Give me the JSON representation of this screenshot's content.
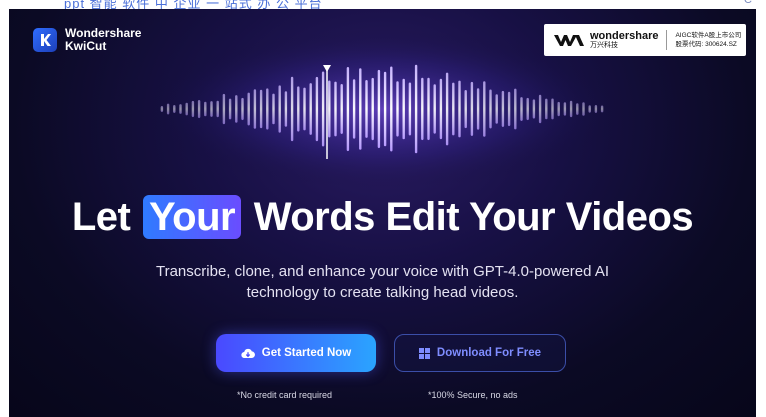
{
  "browser_strip": {
    "text": "ppt 智能 软件 中 企业 一 站式 办 公 平台",
    "right_mark": "C"
  },
  "brand": {
    "line1": "Wondershare",
    "line2": "KwiCut"
  },
  "corporate_badge": {
    "name": "wondershare",
    "name_cn": "万兴科技",
    "info_line1": "AIGC软件A股上市公司",
    "info_line2": "股票代码: 300624.SZ"
  },
  "hero": {
    "headline_before": "Let",
    "headline_highlight": "Your",
    "headline_after": "Words Edit Your Videos",
    "subtitle_line1": "Transcribe, clone, and enhance your voice with GPT-4.0-powered AI",
    "subtitle_line2": "technology to create talking head videos."
  },
  "cta": {
    "primary_label": "Get Started Now",
    "secondary_label": "Download For Free",
    "primary_note": "*No credit card required",
    "secondary_note": "*100% Secure, no ads"
  },
  "colors": {
    "background": "#0b0a24",
    "accent_blue": "#2f7bff",
    "accent_purple": "#6a4dff",
    "wave_glow": "#9b6bff"
  },
  "icons": {
    "brand": "kwicut-k-icon",
    "primary_button": "cloud-download-icon",
    "secondary_button": "windows-icon"
  }
}
